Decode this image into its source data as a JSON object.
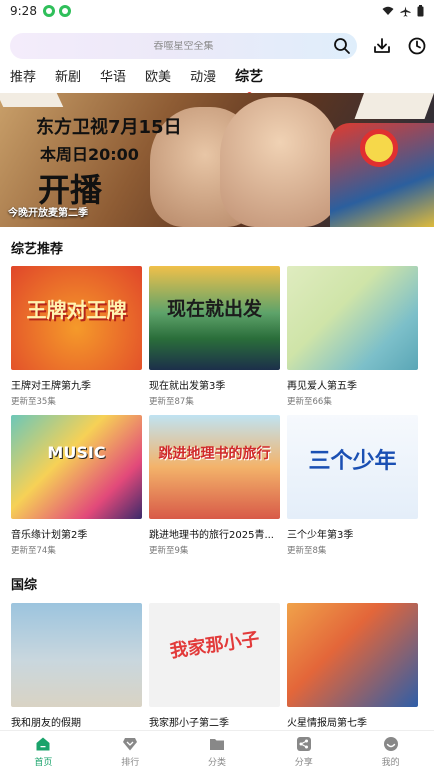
{
  "status_bar": {
    "time": "9:28",
    "icons": [
      "wechat-notif-icon",
      "wechat-notif-icon",
      "wifi-icon",
      "airplane-icon",
      "battery-icon"
    ]
  },
  "search": {
    "placeholder": "吞噬星空全集"
  },
  "top_actions": [
    "download-icon",
    "history-icon"
  ],
  "tabs": [
    {
      "label": "推荐",
      "active": false
    },
    {
      "label": "新剧",
      "active": false
    },
    {
      "label": "华语",
      "active": false
    },
    {
      "label": "欧美",
      "active": false
    },
    {
      "label": "动漫",
      "active": false
    },
    {
      "label": "综艺",
      "active": true
    }
  ],
  "banner": {
    "line1": "东方卫视7月15日",
    "line2": "本周日20:00",
    "line3": "开播",
    "caption": "今晚开放麦第二季"
  },
  "section1": {
    "title": "综艺推荐",
    "items": [
      {
        "title": "王牌对王牌第九季",
        "sub": "更新至35集",
        "thumb_text": "王牌对王牌",
        "colors": [
          "#f59a2a",
          "#e0462a"
        ]
      },
      {
        "title": "现在就出发第3季",
        "sub": "更新至87集",
        "thumb_text": "现在就出发",
        "colors": [
          "#2a6d3a",
          "#f0c04a"
        ]
      },
      {
        "title": "再见爱人第五季",
        "sub": "更新至66集",
        "thumb_text": "",
        "colors": [
          "#cfe4a8",
          "#6fb7c4"
        ]
      },
      {
        "title": "音乐缘计划第2季",
        "sub": "更新至74集",
        "thumb_text": "MUSIC",
        "colors": [
          "#6cc7b8",
          "#e2497a"
        ]
      },
      {
        "title": "跳进地理书的旅行2025青...",
        "sub": "更新至9集",
        "thumb_text": "跳进地理书的旅行",
        "colors": [
          "#f3b36a",
          "#d85a48"
        ]
      },
      {
        "title": "三个少年第3季",
        "sub": "更新至8集",
        "thumb_text": "三个少年",
        "colors": [
          "#eef4fb",
          "#d8e6f6"
        ]
      }
    ]
  },
  "section2": {
    "title": "国综",
    "items": [
      {
        "title": "我和朋友的假期",
        "sub": "",
        "thumb_text": "",
        "colors": [
          "#8fb9d6",
          "#d7dde0"
        ]
      },
      {
        "title": "我家那小子第二季",
        "sub": "",
        "thumb_text": "我家那小子",
        "colors": [
          "#f2f2f2",
          "#e23a3a"
        ]
      },
      {
        "title": "火星情报局第七季",
        "sub": "",
        "thumb_text": "",
        "colors": [
          "#e3663a",
          "#2e5ea8"
        ]
      }
    ]
  },
  "bottom_nav": [
    {
      "label": "首页",
      "icon": "home-icon",
      "active": true
    },
    {
      "label": "排行",
      "icon": "rank-icon",
      "active": false
    },
    {
      "label": "分类",
      "icon": "folder-icon",
      "active": false
    },
    {
      "label": "分享",
      "icon": "share-icon",
      "active": false
    },
    {
      "label": "我的",
      "icon": "profile-icon",
      "active": false
    }
  ],
  "accent_color": "#1aa36b"
}
